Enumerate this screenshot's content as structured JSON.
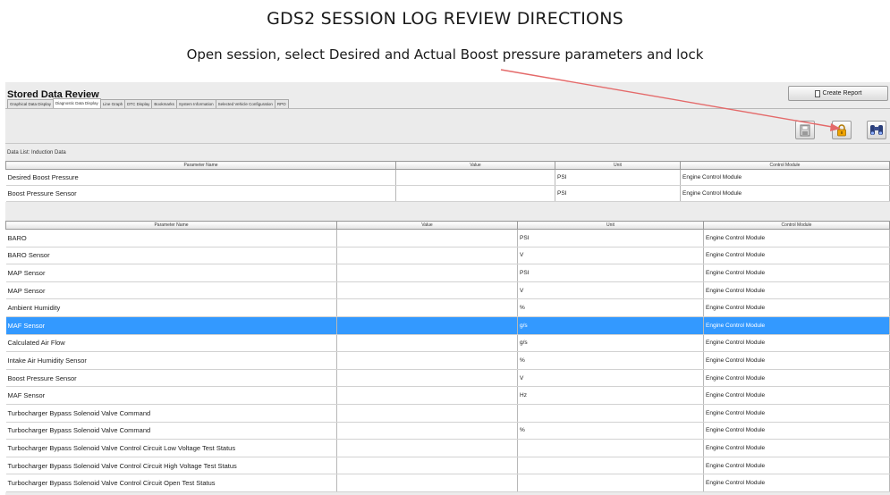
{
  "document": {
    "title": "GDS2 SESSION LOG REVIEW DIRECTIONS",
    "subtitle": "Open session, select Desired and Actual Boost pressure parameters and lock"
  },
  "colors": {
    "selection": "#3399ff",
    "annotation_arrow": "#e46a6a",
    "lock_icon": "#f0a400"
  },
  "app": {
    "title": "Stored Data Review",
    "create_report_label": "Create Report",
    "tabs": [
      {
        "label": "Graphical Data Display",
        "active": false
      },
      {
        "label": "Diagnostic Data Display",
        "active": true
      },
      {
        "label": "Line Graph",
        "active": false
      },
      {
        "label": "DTC Display",
        "active": false
      },
      {
        "label": "Bookmarks",
        "active": false
      },
      {
        "label": "System Information",
        "active": false
      },
      {
        "label": "Selected Vehicle Configuration",
        "active": false
      },
      {
        "label": "RPO",
        "active": false
      }
    ],
    "toolbar_icons": [
      "save-icon",
      "lock-icon",
      "binoculars-icon"
    ],
    "data_list_label": "Data List: Induction Data"
  },
  "locked_table": {
    "headers": [
      "Parameter Name",
      "Value",
      "Unit",
      "Control Module"
    ],
    "rows": [
      [
        "Desired Boost Pressure",
        "",
        "PSI",
        "Engine Control Module"
      ],
      [
        "Boost Pressure Sensor",
        "",
        "PSI",
        "Engine Control Module"
      ]
    ]
  },
  "main_table": {
    "headers": [
      "Parameter Name",
      "Value",
      "Unit",
      "Control Module"
    ],
    "selected_row_index": 5,
    "rows": [
      [
        "BARO",
        "",
        "PSI",
        "Engine Control Module"
      ],
      [
        "BARO Sensor",
        "",
        "V",
        "Engine Control Module"
      ],
      [
        "MAP Sensor",
        "",
        "PSI",
        "Engine Control Module"
      ],
      [
        "MAP Sensor",
        "",
        "V",
        "Engine Control Module"
      ],
      [
        "Ambient Humidity",
        "",
        "%",
        "Engine Control Module"
      ],
      [
        "MAF Sensor",
        "",
        "g/s",
        "Engine Control Module"
      ],
      [
        "Calculated Air Flow",
        "",
        "g/s",
        "Engine Control Module"
      ],
      [
        "Intake Air Humidity Sensor",
        "",
        "%",
        "Engine Control Module"
      ],
      [
        "Boost Pressure Sensor",
        "",
        "V",
        "Engine Control Module"
      ],
      [
        "MAF Sensor",
        "",
        "Hz",
        "Engine Control Module"
      ],
      [
        "Turbocharger Bypass Solenoid Valve Command",
        "",
        "",
        "Engine Control Module"
      ],
      [
        "Turbocharger Bypass Solenoid Valve Command",
        "",
        "%",
        "Engine Control Module"
      ],
      [
        "Turbocharger Bypass Solenoid Valve Control Circuit Low Voltage Test Status",
        "",
        "",
        "Engine Control Module"
      ],
      [
        "Turbocharger Bypass Solenoid Valve Control Circuit High Voltage Test Status",
        "",
        "",
        "Engine Control Module"
      ],
      [
        "Turbocharger Bypass Solenoid Valve Control Circuit Open Test Status",
        "",
        "",
        "Engine Control Module"
      ]
    ]
  }
}
